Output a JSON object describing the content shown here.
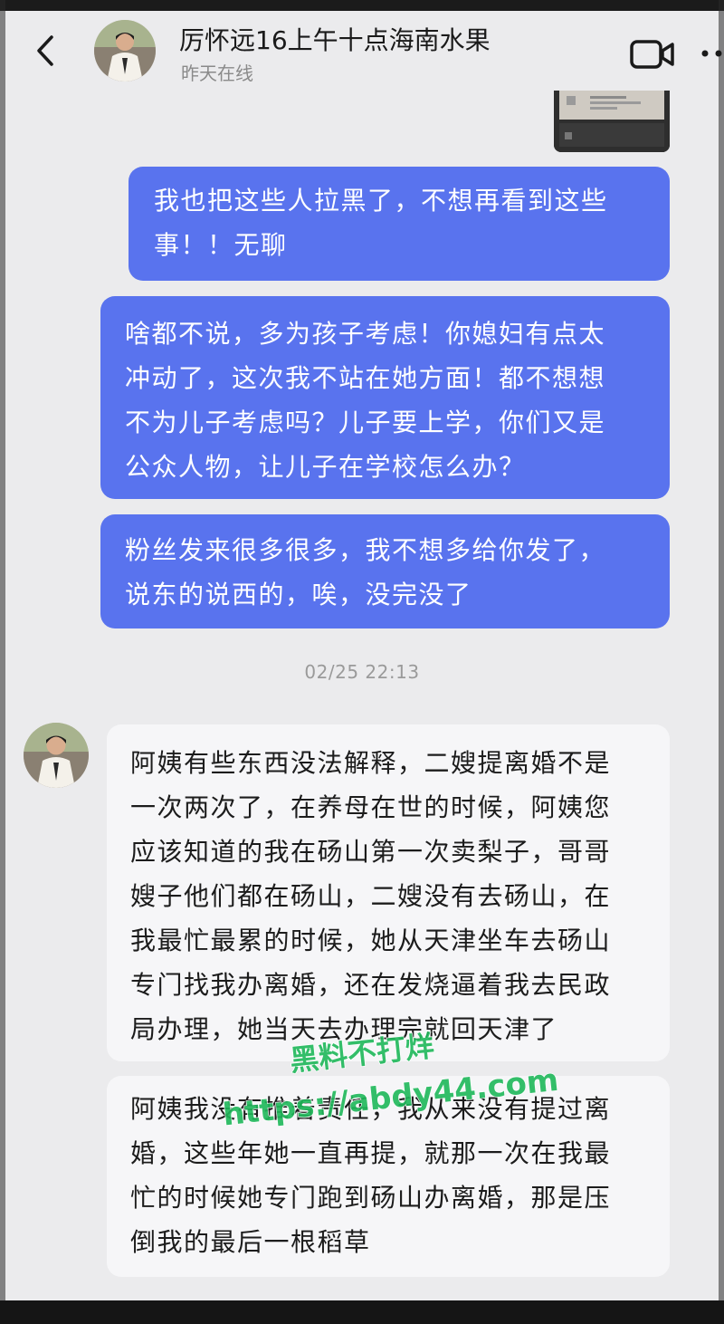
{
  "header": {
    "contact_name": "厉怀远16上午十点海南水果",
    "status": "昨天在线"
  },
  "icons": {
    "back": "chevron-left-icon",
    "video": "video-camera-icon",
    "more": "more-dots-icon"
  },
  "colors": {
    "outgoing_bubble": "#5973ee",
    "incoming_bubble": "#f6f6f8",
    "background": "#ebebed",
    "watermark": "#1fb85a"
  },
  "messages": [
    {
      "sender": "me",
      "lines": [
        "我也把这些人拉黑了，不想再看到这些",
        "事！！无聊"
      ]
    },
    {
      "sender": "me",
      "lines": [
        "啥都不说，多为孩子考虑！你媳妇有点太",
        "冲动了，这次我不站在她方面！都不想想",
        "不为儿子考虑吗？儿子要上学，你们又是",
        "公众人物，让儿子在学校怎么办？"
      ]
    },
    {
      "sender": "me",
      "lines": [
        "粉丝发来很多很多，我不想多给你发了，",
        "说东的说西的，唉，没完没了"
      ]
    },
    {
      "sender": "them",
      "lines": [
        "阿姨有些东西没法解释，二嫂提离婚不是",
        "一次两次了，在养母在世的时候，阿姨您",
        "应该知道的我在砀山第一次卖梨子，哥哥",
        "嫂子他们都在砀山，二嫂没有去砀山，在",
        "我最忙最累的时候，她从天津坐车去砀山",
        "专门找我办离婚，还在发烧逼着我去民政",
        "局办理，她当天去办理完就回天津了"
      ]
    },
    {
      "sender": "them",
      "lines": [
        "阿姨我没有推着责任，我从来没有提过离",
        "婚，这些年她一直再提，就那一次在我最",
        "忙的时候她专门跑到砀山办离婚，那是压",
        "倒我的最后一根稻草"
      ]
    }
  ],
  "timestamp": "02/25 22:13",
  "watermark": {
    "line1": "黑料不打烊",
    "line2": "https://abdy44.com"
  }
}
